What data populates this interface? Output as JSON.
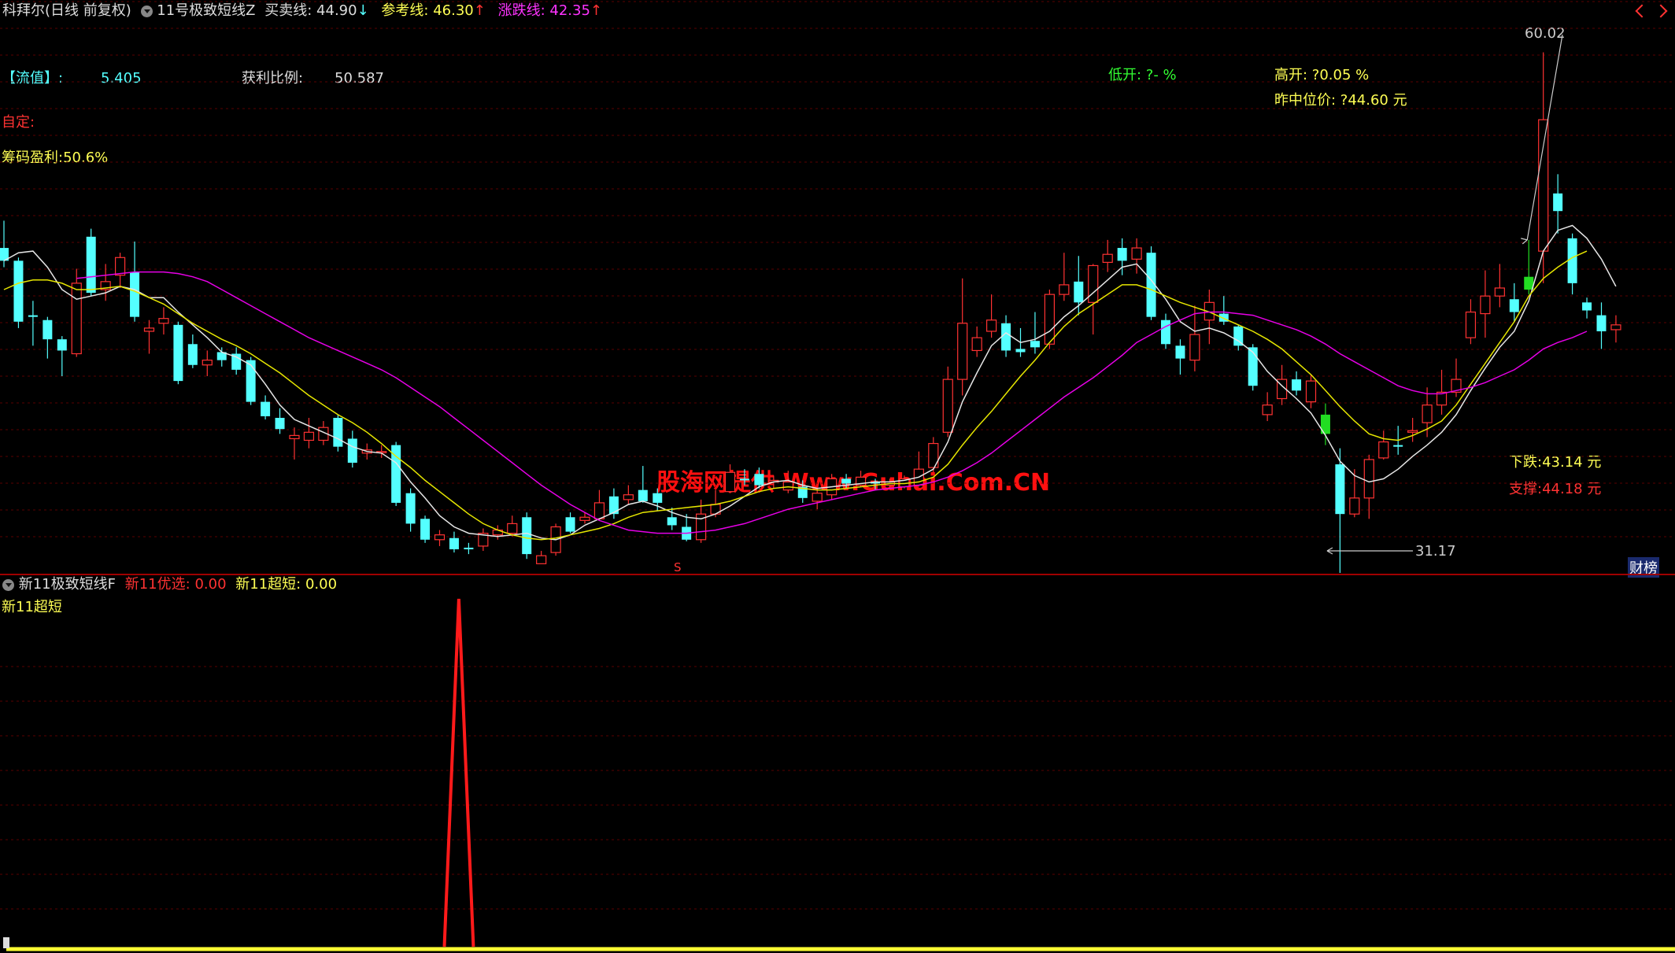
{
  "header": {
    "stock_title": "科拜尔(日线 前复权)",
    "indicator_name": "11号极致短线Z",
    "buy_sell_label": "买卖线:",
    "buy_sell_value": "44.90",
    "buy_sell_arrow": "↓",
    "ref_label": "参考线:",
    "ref_value": "46.30",
    "ref_arrow": "↑",
    "zd_label": "涨跌线:",
    "zd_value": "42.35",
    "zd_arrow": "↑"
  },
  "info": {
    "liuzhi_label": "【流值】:",
    "liuzhi_value": "5.405",
    "profit_ratio_label": "获利比例:",
    "profit_ratio_value": "50.587",
    "low_open": "低开: ?- %",
    "high_open": "高开: ?0.05 %",
    "prev_mid_price": "昨中位价: ?44.60 元",
    "custom_label": "自定:",
    "chip_profit": "筹码盈利:50.6%",
    "down_label": "下跌:43.14 元",
    "support_label": "支撑:44.18 元",
    "max_price_label": "60.02",
    "min_price_label": "31.17",
    "s_marker": "S",
    "finance_badge": "财榜",
    "watermark": "股海网提供 Www.Guhai.Com.CN"
  },
  "sub_panel": {
    "indicator_name": "新11极致短线F",
    "youxuan_label": "新11优选:",
    "youxuan_value": "0.00",
    "chaoduan_label": "新11超短:",
    "chaoduan_value": "0.00",
    "line_label": "新11超短"
  },
  "colors": {
    "up": "#ff3232",
    "down": "#54ffff",
    "ma_white": "#e6e6e6",
    "ma_yellow": "#e6e600",
    "ma_magenta": "#e600e6",
    "grid": "#5a0000",
    "yellow_text": "#ffff54",
    "cyan_text": "#54ffff",
    "green_text": "#33ff33",
    "red_text": "#ff3232",
    "magenta_text": "#ff33ff"
  },
  "chart_data": {
    "type": "candlestick",
    "price_range": [
      29.0,
      61.5
    ],
    "candles": [
      [
        47.8,
        47.0,
        49.5,
        46.6
      ],
      [
        47.0,
        43.2,
        47.2,
        42.8
      ],
      [
        43.6,
        43.5,
        44.5,
        41.7
      ],
      [
        43.3,
        42.1,
        43.5,
        40.9
      ],
      [
        42.1,
        41.4,
        42.3,
        39.8
      ],
      [
        41.2,
        45.6,
        46.5,
        41.0
      ],
      [
        48.5,
        45.0,
        49.0,
        44.8
      ],
      [
        45.2,
        45.7,
        46.8,
        44.5
      ],
      [
        46.1,
        47.2,
        47.5,
        45.3
      ],
      [
        46.3,
        43.5,
        48.2,
        43.2
      ],
      [
        42.6,
        42.8,
        43.3,
        41.2
      ],
      [
        43.1,
        43.4,
        44.1,
        42.4
      ],
      [
        43.0,
        39.5,
        43.2,
        39.3
      ],
      [
        41.8,
        40.5,
        42.4,
        40.3
      ],
      [
        40.5,
        40.8,
        41.4,
        39.8
      ],
      [
        41.3,
        40.8,
        41.6,
        40.4
      ],
      [
        41.2,
        40.2,
        41.6,
        39.9
      ],
      [
        40.8,
        38.2,
        41.0,
        38.0
      ],
      [
        38.2,
        37.3,
        38.6,
        37.1
      ],
      [
        37.2,
        36.5,
        37.8,
        36.2
      ],
      [
        35.9,
        36.1,
        36.6,
        34.6
      ],
      [
        35.8,
        36.3,
        37.2,
        35.3
      ],
      [
        35.8,
        36.6,
        37.0,
        35.5
      ],
      [
        37.2,
        35.4,
        37.4,
        35.1
      ],
      [
        35.9,
        34.4,
        36.4,
        34.1
      ],
      [
        35.0,
        35.2,
        35.6,
        34.6
      ],
      [
        35.1,
        35.1,
        35.5,
        34.7
      ],
      [
        35.5,
        31.9,
        35.7,
        31.7
      ],
      [
        32.5,
        30.6,
        32.8,
        30.1
      ],
      [
        30.9,
        29.6,
        31.1,
        29.4
      ],
      [
        29.6,
        29.9,
        30.2,
        29.2
      ],
      [
        29.7,
        29.0,
        30.1,
        28.8
      ],
      [
        29.1,
        29.0,
        29.4,
        28.7
      ],
      [
        29.2,
        30.0,
        30.3,
        28.9
      ],
      [
        29.9,
        30.2,
        30.5,
        29.6
      ],
      [
        30.0,
        30.6,
        31.1,
        29.8
      ],
      [
        31.0,
        28.7,
        31.3,
        28.4
      ],
      [
        28.1,
        28.6,
        28.9,
        28.2
      ],
      [
        28.8,
        30.4,
        30.6,
        28.6
      ],
      [
        31.0,
        30.1,
        31.3,
        30.0
      ],
      [
        30.8,
        31.0,
        31.3,
        30.6
      ],
      [
        30.9,
        31.9,
        32.7,
        30.8
      ],
      [
        32.3,
        31.2,
        32.8,
        30.9
      ],
      [
        32.1,
        32.4,
        33.0,
        31.8
      ],
      [
        32.7,
        32.0,
        34.2,
        31.9
      ],
      [
        32.5,
        31.9,
        32.8,
        31.4
      ],
      [
        31.0,
        30.5,
        31.6,
        30.2
      ],
      [
        30.4,
        29.6,
        31.2,
        29.5
      ],
      [
        29.6,
        31.2,
        32.1,
        29.4
      ],
      [
        31.2,
        31.8,
        32.7,
        31.0
      ],
      [
        32.6,
        33.8,
        34.3,
        32.5
      ],
      [
        33.4,
        33.3,
        34.0,
        33.0
      ],
      [
        33.7,
        33.0,
        34.1,
        32.8
      ],
      [
        33.2,
        33.3,
        33.6,
        32.8
      ],
      [
        32.7,
        33.2,
        33.9,
        32.5
      ],
      [
        32.9,
        32.2,
        33.3,
        31.9
      ],
      [
        32.0,
        32.5,
        32.8,
        31.5
      ],
      [
        32.4,
        33.4,
        33.7,
        32.1
      ],
      [
        33.4,
        33.1,
        33.7,
        32.8
      ],
      [
        33.0,
        33.5,
        33.9,
        32.9
      ],
      [
        33.2,
        33.1,
        33.4,
        32.7
      ],
      [
        33.0,
        33.2,
        33.4,
        32.7
      ],
      [
        32.9,
        33.4,
        33.6,
        32.8
      ],
      [
        33.0,
        34.0,
        35.1,
        32.9
      ],
      [
        34.1,
        35.6,
        36.0,
        33.8
      ],
      [
        36.3,
        39.6,
        40.4,
        36.0
      ],
      [
        39.6,
        43.1,
        45.9,
        38.6
      ],
      [
        41.4,
        42.2,
        42.9,
        41.0
      ],
      [
        42.6,
        43.3,
        44.9,
        42.2
      ],
      [
        43.1,
        41.4,
        43.6,
        41.0
      ],
      [
        41.5,
        41.3,
        42.8,
        41.0
      ],
      [
        42.0,
        41.6,
        43.8,
        41.2
      ],
      [
        41.8,
        44.9,
        45.2,
        41.5
      ],
      [
        44.9,
        45.5,
        47.5,
        44.5
      ],
      [
        45.7,
        44.4,
        47.3,
        43.6
      ],
      [
        44.4,
        46.7,
        46.8,
        42.4
      ],
      [
        46.9,
        47.4,
        48.3,
        46.3
      ],
      [
        47.8,
        47.0,
        48.4,
        46.1
      ],
      [
        47.1,
        47.8,
        48.4,
        46.2
      ],
      [
        47.5,
        43.5,
        47.9,
        43.3
      ],
      [
        43.3,
        41.8,
        43.7,
        41.5
      ],
      [
        41.7,
        40.9,
        42.1,
        39.9
      ],
      [
        40.8,
        42.4,
        44.2,
        40.1
      ],
      [
        43.3,
        44.4,
        45.2,
        41.8
      ],
      [
        43.7,
        43.2,
        44.8,
        43.0
      ],
      [
        42.9,
        41.7,
        43.0,
        41.4
      ],
      [
        41.6,
        39.2,
        41.8,
        38.9
      ],
      [
        37.4,
        38.0,
        38.8,
        37.0
      ],
      [
        38.4,
        39.6,
        40.5,
        38.0
      ],
      [
        39.6,
        38.9,
        40.1,
        38.6
      ],
      [
        38.2,
        39.5,
        39.9,
        37.8
      ],
      [
        37.4,
        36.2,
        38.1,
        35.5
      ],
      [
        34.3,
        31.2,
        35.3,
        27.3
      ],
      [
        31.2,
        32.2,
        34.0,
        31.0
      ],
      [
        32.2,
        34.6,
        34.9,
        30.9
      ],
      [
        34.7,
        35.7,
        36.4,
        34.6
      ],
      [
        35.5,
        35.4,
        36.7,
        34.9
      ],
      [
        36.3,
        36.4,
        37.2,
        35.7
      ],
      [
        36.9,
        38.0,
        39.1,
        36.0
      ],
      [
        38.0,
        38.8,
        40.2,
        37.4
      ],
      [
        38.8,
        39.6,
        40.9,
        38.5
      ],
      [
        42.2,
        43.8,
        44.6,
        41.8
      ],
      [
        43.7,
        44.8,
        46.4,
        42.2
      ],
      [
        44.8,
        45.3,
        46.8,
        44.1
      ],
      [
        44.6,
        43.8,
        45.6,
        43.2
      ],
      [
        45.2,
        46.0,
        48.3,
        44.9
      ],
      [
        47.6,
        55.8,
        60.0,
        45.6
      ],
      [
        51.2,
        50.1,
        52.4,
        48.7
      ],
      [
        48.4,
        45.6,
        48.7,
        44.9
      ],
      [
        44.4,
        43.9,
        44.7,
        43.4
      ],
      [
        43.6,
        42.6,
        44.4,
        41.5
      ],
      [
        42.7,
        43.0,
        43.6,
        41.9
      ]
    ],
    "special_candles": {
      "91": "#22dd22",
      "105": "#22dd22"
    },
    "ma_white": [
      47.0,
      47.5,
      47.6,
      46.6,
      45.2,
      44.6,
      44.8,
      45.0,
      45.4,
      45.2,
      44.7,
      44.7,
      43.8,
      43.0,
      42.2,
      41.3,
      41.0,
      40.5,
      39.3,
      38.0,
      37.1,
      36.7,
      36.3,
      35.9,
      35.4,
      35.1,
      35.0,
      34.4,
      33.2,
      32.2,
      31.1,
      30.4,
      30.0,
      29.9,
      29.8,
      29.9,
      30.0,
      29.7,
      29.6,
      29.9,
      30.5,
      30.9,
      31.3,
      31.8,
      32.0,
      31.7,
      31.3,
      31.0,
      30.9,
      31.2,
      31.7,
      32.3,
      32.9,
      33.2,
      33.3,
      33.0,
      32.8,
      32.9,
      33.0,
      33.1,
      33.2,
      33.2,
      33.3,
      33.5,
      34.0,
      35.7,
      38.2,
      40.0,
      41.7,
      42.5,
      41.9,
      42.1,
      42.6,
      43.5,
      44.2,
      45.0,
      45.8,
      46.6,
      46.8,
      45.8,
      44.6,
      43.2,
      42.6,
      42.8,
      42.5,
      42.0,
      41.3,
      40.1,
      39.2,
      38.4,
      37.5,
      36.1,
      34.5,
      33.6,
      33.2,
      33.4,
      34.0,
      34.8,
      35.5,
      36.3,
      37.4,
      38.9,
      40.3,
      41.6,
      42.6,
      44.5,
      47.6,
      48.9,
      49.2,
      48.4,
      47.1,
      45.4
    ],
    "ma_yellow": [
      45.2,
      45.6,
      45.8,
      45.8,
      45.6,
      45.2,
      45.2,
      45.3,
      45.4,
      45.1,
      44.7,
      44.3,
      43.7,
      43.1,
      42.6,
      42.1,
      41.7,
      41.2,
      40.6,
      40.0,
      39.3,
      38.6,
      38.0,
      37.4,
      36.9,
      36.3,
      35.6,
      34.8,
      34.1,
      33.3,
      32.6,
      31.9,
      31.2,
      30.6,
      30.2,
      29.9,
      29.7,
      29.6,
      29.7,
      29.9,
      30.1,
      30.3,
      30.6,
      31.0,
      31.3,
      31.4,
      31.5,
      31.6,
      31.7,
      31.8,
      32.0,
      32.3,
      32.6,
      32.8,
      32.9,
      32.8,
      32.7,
      32.7,
      32.8,
      32.9,
      33.0,
      33.1,
      33.1,
      33.2,
      33.5,
      34.3,
      35.5,
      36.6,
      37.6,
      38.7,
      39.8,
      40.8,
      41.9,
      42.9,
      43.7,
      44.3,
      44.9,
      45.5,
      45.5,
      45.2,
      44.8,
      44.4,
      44.1,
      43.8,
      43.4,
      43.0,
      42.6,
      42.1,
      41.5,
      40.7,
      39.9,
      38.9,
      37.9,
      37.0,
      36.2,
      35.9,
      35.8,
      36.1,
      36.5,
      37.0,
      38.0,
      39.3,
      40.6,
      41.9,
      43.2,
      44.8,
      45.9,
      46.6,
      47.2,
      47.6
    ],
    "ma_magenta": [
      null,
      null,
      null,
      null,
      null,
      45.9,
      46.0,
      46.1,
      46.2,
      46.3,
      46.3,
      46.3,
      46.2,
      46.0,
      45.7,
      45.2,
      44.7,
      44.2,
      43.7,
      43.2,
      42.7,
      42.2,
      41.8,
      41.4,
      41.0,
      40.6,
      40.2,
      39.7,
      39.1,
      38.5,
      37.9,
      37.2,
      36.5,
      35.8,
      35.1,
      34.4,
      33.7,
      33.0,
      32.4,
      31.8,
      31.3,
      30.8,
      30.5,
      30.2,
      30.1,
      30.0,
      30.0,
      30.0,
      30.1,
      30.2,
      30.4,
      30.6,
      30.9,
      31.2,
      31.5,
      31.7,
      31.9,
      32.1,
      32.3,
      32.5,
      32.7,
      32.8,
      32.9,
      33.0,
      33.2,
      33.5,
      33.9,
      34.4,
      35.0,
      35.7,
      36.4,
      37.1,
      37.8,
      38.5,
      39.1,
      39.7,
      40.4,
      41.1,
      41.9,
      42.4,
      42.9,
      43.3,
      43.7,
      43.8,
      43.8,
      43.7,
      43.6,
      43.3,
      43.0,
      42.7,
      42.3,
      41.8,
      41.2,
      40.7,
      40.2,
      39.7,
      39.2,
      38.9,
      38.7,
      38.7,
      38.9,
      39.1,
      39.4,
      39.8,
      40.2,
      40.8,
      41.5,
      41.9,
      42.2,
      42.6
    ],
    "sub_spike_index": 31,
    "sub_range": [
      0,
      1
    ]
  }
}
